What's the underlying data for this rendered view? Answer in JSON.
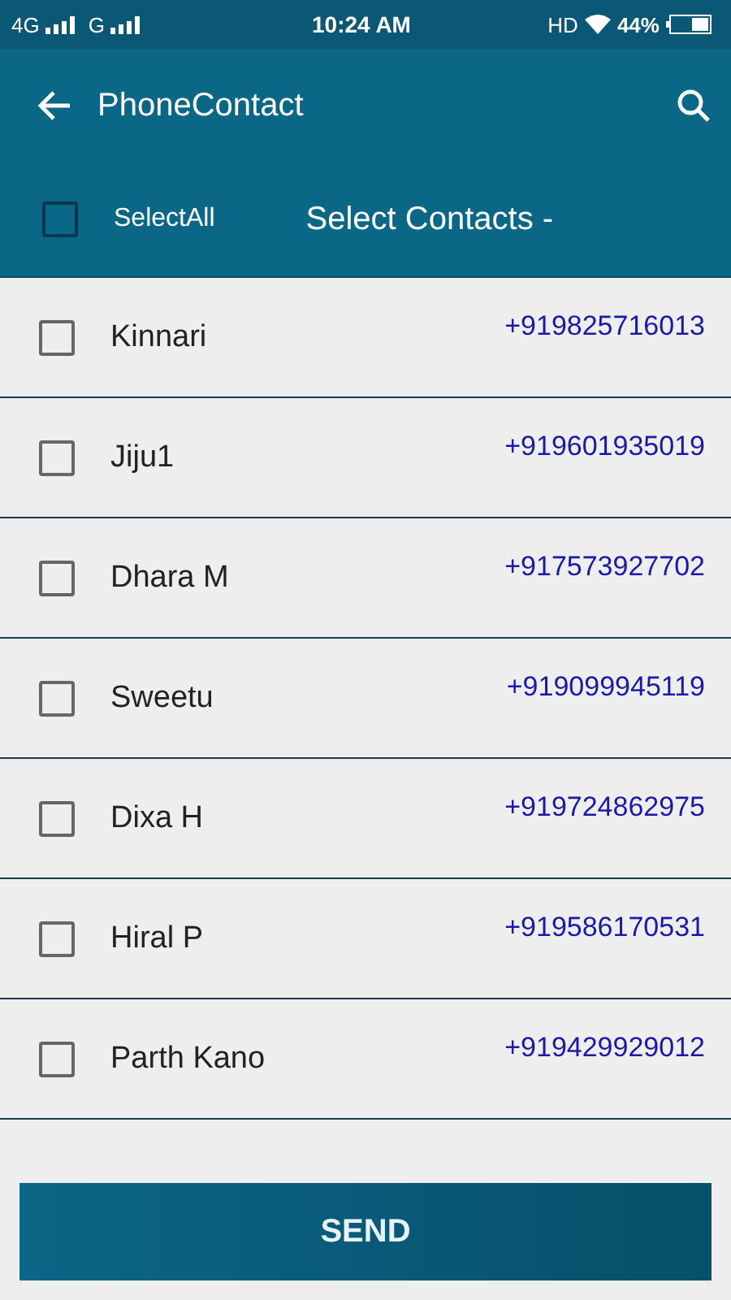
{
  "status_bar": {
    "network_1": "4G",
    "network_2": "G",
    "time": "10:24 AM",
    "hd": "HD",
    "battery": "44%"
  },
  "toolbar": {
    "title": "PhoneContact"
  },
  "select_bar": {
    "select_all": {
      "label": "SelectAll",
      "checked": false
    },
    "title": "Select Contacts -"
  },
  "contacts": [
    {
      "name": "Kinnari",
      "phone": "+919825716013",
      "checked": false
    },
    {
      "name": "Jiju1",
      "phone": "+919601935019",
      "checked": false
    },
    {
      "name": "Dhara M",
      "phone": "+917573927702",
      "checked": false
    },
    {
      "name": "Sweetu",
      "phone": "+919099945119",
      "checked": false
    },
    {
      "name": "Dixa H",
      "phone": "+919724862975",
      "checked": false
    },
    {
      "name": "Hiral P",
      "phone": "+919586170531",
      "checked": false
    },
    {
      "name": "Parth Kano",
      "phone": "+919429929012",
      "checked": false
    }
  ],
  "send_button": "SEND"
}
